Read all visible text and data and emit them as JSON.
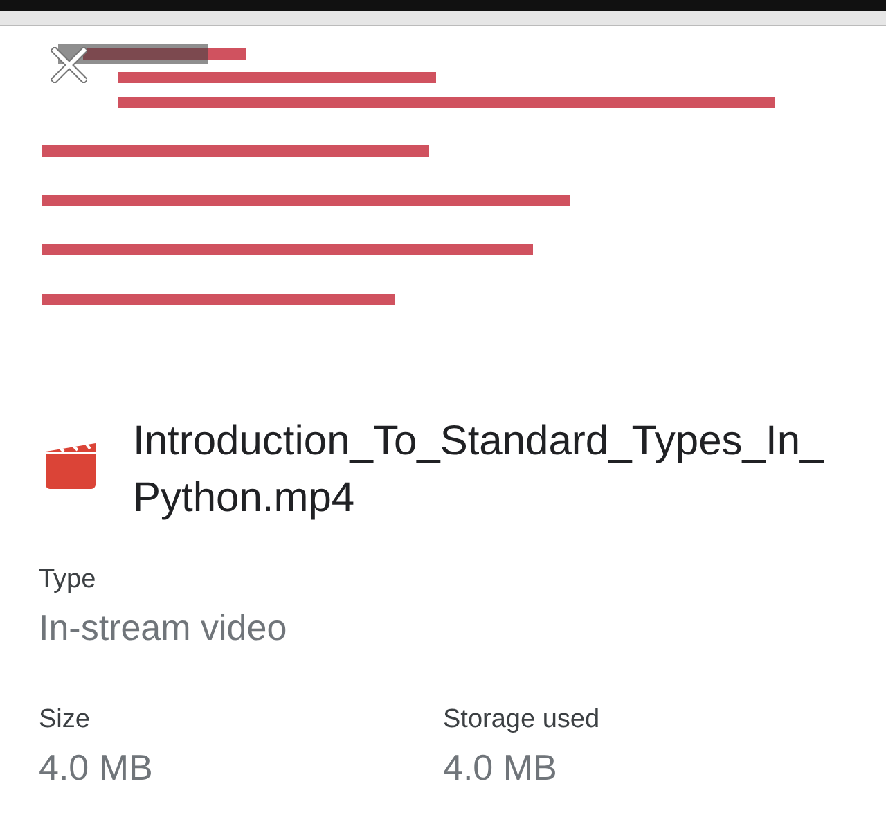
{
  "file": {
    "name": "Introduction_To_Standard_Types_In_Python.mp4"
  },
  "details": [
    {
      "label": "Type",
      "value": "In-stream video"
    }
  ],
  "stats": [
    {
      "label": "Size",
      "value": "4.0 MB"
    },
    {
      "label": "Storage used",
      "value": "4.0 MB"
    }
  ]
}
